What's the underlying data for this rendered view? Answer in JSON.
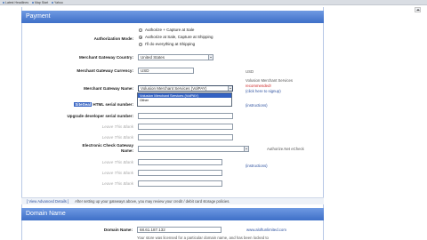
{
  "browser": {
    "bookmarks": [
      "Latest Headlines",
      "Map Start",
      "Yahoo"
    ]
  },
  "payment": {
    "title": "Payment",
    "authorization_mode": {
      "label": "Authorization Mode:",
      "options": [
        "Authorize + Capture at Sale",
        "Authorize at Sale, Capture at Shipping",
        "I'll do everything at Shipping"
      ],
      "selected_index": 1
    },
    "merchant_gateway_country": {
      "label": "Merchant Gateway Country:",
      "value": "United States"
    },
    "merchant_gateway_currency": {
      "label": "Merchant Gateway Currency:",
      "value": "USD",
      "right_text": "USD"
    },
    "merchant_gateway_name": {
      "label": "Merchant Gateway Name:",
      "value": "Volusion Merchant Services (VolPAY)",
      "dropdown_options": [
        "Volusion Merchant Services (VolPAY)",
        "Other"
      ],
      "right_title": "Volusion Merchant Services",
      "right_red": "recommended!",
      "right_link": "(click here to signup)"
    },
    "serial_number": {
      "label_highlight": "SiteSeal",
      "label_rest": " HTML serial number:",
      "right_link": "(instructions)"
    },
    "upgrade_serial": {
      "label": "Upgrade developer serial number:"
    },
    "leave_blank_1": "Leave This Blank",
    "leave_blank_2": "Leave This Blank",
    "echeck_gateway": {
      "label_line1": "Electronic Check Gateway",
      "label_line2": "Name:",
      "right_text": "Authorize.Net eCheck",
      "right_link": "(instructions)"
    },
    "leave_blank_3": "Leave This Blank",
    "leave_blank_4": "Leave This Blank",
    "leave_blank_5": "Leave This Blank",
    "view_advanced": "[ View Advanced Details ]",
    "note": "After setting up your gateways above, you may review your credit / debit card storage policies."
  },
  "domain": {
    "title": "Domain Name",
    "domain_name": {
      "label": "Domain Name:",
      "value": "68.61.187.132",
      "right_link": "www.aloftunlimited.com"
    },
    "notice": "Your store was licensed for a particular domain name, and has been locked to"
  }
}
